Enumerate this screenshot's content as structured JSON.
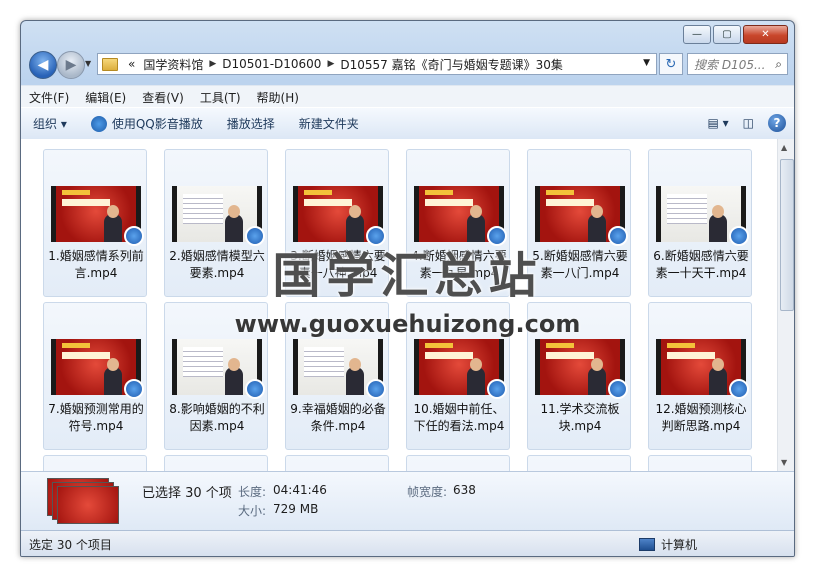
{
  "window": {
    "controls": {
      "minimize": "—",
      "maximize": "▢",
      "close": "✕"
    }
  },
  "nav": {
    "back_icon": "◀",
    "forward_icon": "▶",
    "breadcrumb": [
      "«",
      "国学资料馆",
      "D10501-D10600",
      "D10557 嘉铭《奇门与婚姻专题课》30集"
    ],
    "search_placeholder": "搜索 D105..."
  },
  "menubar": [
    "文件(F)",
    "编辑(E)",
    "查看(V)",
    "工具(T)",
    "帮助(H)"
  ],
  "commands": {
    "organize": "组织 ▾",
    "play_qq": "使用QQ影音播放",
    "play_selection": "播放选择",
    "new_folder": "新建文件夹"
  },
  "files": [
    {
      "name": "1.婚姻感情系列前言.mp4",
      "thumb": "red"
    },
    {
      "name": "2.婚姻感情模型六要素.mp4",
      "thumb": "white"
    },
    {
      "name": "3.断婚姻感情六要素一八神.mp4",
      "thumb": "red"
    },
    {
      "name": "4.断婚姻感情六要素一九星.mp4",
      "thumb": "red"
    },
    {
      "name": "5.断婚姻感情六要素一八门.mp4",
      "thumb": "red"
    },
    {
      "name": "6.断婚姻感情六要素一十天干.mp4",
      "thumb": "white"
    },
    {
      "name": "7.婚姻预测常用的符号.mp4",
      "thumb": "red"
    },
    {
      "name": "8.影响婚姻的不利因素.mp4",
      "thumb": "white"
    },
    {
      "name": "9.幸福婚姻的必备条件.mp4",
      "thumb": "white"
    },
    {
      "name": "10.婚姻中前任、下任的看法.mp4",
      "thumb": "red"
    },
    {
      "name": "11.学术交流板块.mp4",
      "thumb": "red"
    },
    {
      "name": "12.婚姻预测核心判断思路.mp4",
      "thumb": "red"
    }
  ],
  "details": {
    "selected": "已选择 30 个项",
    "length_label": "长度:",
    "length_value": "04:41:46",
    "size_label": "大小:",
    "size_value": "729 MB",
    "framewidth_label": "帧宽度:",
    "framewidth_value": "638"
  },
  "status": {
    "left": "选定 30 个项目",
    "right": "计算机"
  },
  "watermark": {
    "title": "国学汇总站",
    "url": "www.guoxuehuizong.com"
  }
}
